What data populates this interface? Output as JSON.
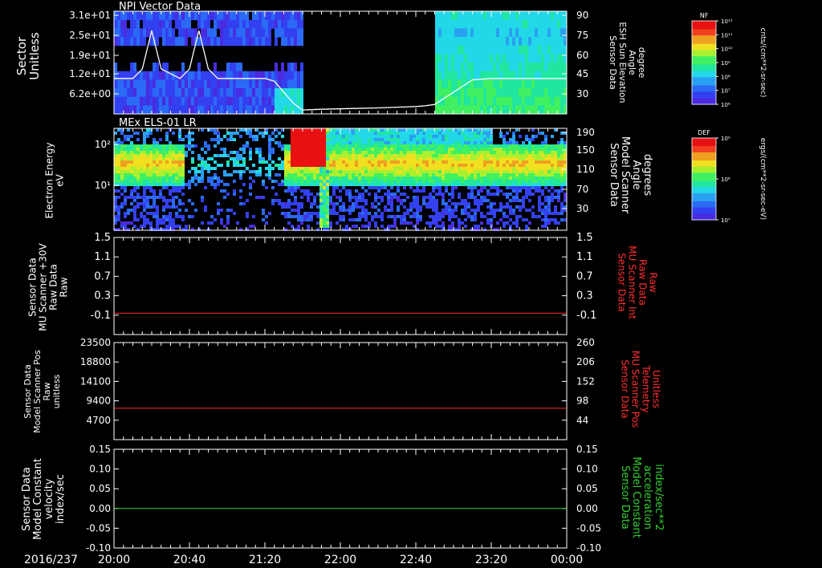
{
  "chart_data": [
    {
      "type": "heatmap",
      "title": "NPI Vector Data",
      "ylabel_left": [
        "Sector",
        "Unitless"
      ],
      "yticks_left": [
        "3.1e+01",
        "2.5e+01",
        "1.9e+01",
        "1.2e+01",
        "6.2e+00"
      ],
      "ylabel_right": [
        "Sensor Data",
        "ESH Sun Elevation",
        "Angle",
        "degree"
      ],
      "yticks_right": [
        "90",
        "75",
        "60",
        "45",
        "30"
      ],
      "colorbar": {
        "title": "NF",
        "ticks": [
          "10¹²",
          "10¹¹",
          "10¹⁰",
          "10⁹",
          "10⁸",
          "10⁷",
          "10⁶"
        ],
        "unit": "cnts/(cm**2-sr-sec)"
      },
      "overlay_line": {
        "name": "ESH Sun Elevation Angle",
        "x": [
          0,
          10,
          15,
          20,
          25,
          35,
          40,
          45,
          50,
          55,
          60,
          70,
          75,
          80,
          85,
          90,
          95,
          100,
          110,
          125,
          140,
          150,
          160,
          165,
          170,
          180,
          190,
          200,
          210,
          220,
          240
        ],
        "y": [
          45,
          45,
          52,
          80,
          52,
          45,
          52,
          80,
          52,
          45,
          45,
          45,
          45,
          45,
          43,
          35,
          27,
          22,
          22.5,
          23,
          23.5,
          24,
          24.5,
          25,
          26,
          35,
          44,
          45,
          45,
          45,
          45
        ]
      }
    },
    {
      "type": "heatmap",
      "title": "MEx ELS-01 LR",
      "ylabel_left": [
        "Electron Energy",
        "eV"
      ],
      "yticks_left": [
        "10²",
        "10¹"
      ],
      "ylabel_right": [
        "Sensor Data",
        "Model Scanner",
        "Angle",
        "degrees"
      ],
      "yticks_right": [
        "190",
        "150",
        "110",
        "70",
        "30"
      ],
      "colorbar": {
        "title": "DEF",
        "ticks": [
          "10⁹",
          "10⁸",
          "10⁷"
        ],
        "unit": "ergs/(cm**2-sr-sec-eV)"
      }
    },
    {
      "type": "line",
      "ylabel_left": [
        "Sensor Data",
        "MU Scanner +30V",
        "Raw Data",
        "Raw"
      ],
      "yticks_left": [
        "1.5",
        "1.1",
        "0.7",
        "0.3",
        "-0.1"
      ],
      "ylabel_right": [
        "Sensor Data",
        "MU Scanner Int",
        "Raw Data",
        "Raw"
      ],
      "yticks_right": [
        "1.5",
        "1.1",
        "0.7",
        "0.3",
        "-0.1"
      ],
      "ylim": [
        -0.5,
        1.5
      ],
      "series": [
        {
          "x": [
            0,
            240
          ],
          "y": [
            -0.06,
            -0.06
          ],
          "color": "#ff3030"
        }
      ]
    },
    {
      "type": "line",
      "ylabel_left": [
        "Sensor Data",
        "Model Scanner Pos",
        "Raw",
        "unitless"
      ],
      "yticks_left": [
        "23500",
        "18800",
        "14100",
        "9400",
        "4700"
      ],
      "ylabel_right": [
        "Sensor Data",
        "MU Scanner Pos",
        "Telemetry",
        "Unitless"
      ],
      "yticks_right": [
        "260",
        "206",
        "152",
        "98",
        "44"
      ],
      "ylim": [
        0,
        23500
      ],
      "series": [
        {
          "x": [
            0,
            240
          ],
          "y": [
            7600,
            7600
          ],
          "color": "#ff3030"
        }
      ]
    },
    {
      "type": "line",
      "ylabel_left": [
        "Sensor Data",
        "Model Constant",
        "velocity",
        "index/sec"
      ],
      "yticks_left": [
        "0.15",
        "0.10",
        "0.05",
        "0.00",
        "-0.05",
        "-0.10"
      ],
      "ylabel_right": [
        "Sensor Data",
        "Model Constant",
        "acceleration",
        "index/sec**2"
      ],
      "yticks_right": [
        "0.15",
        "0.10",
        "0.05",
        "0.00",
        "-0.05",
        "-0.10"
      ],
      "ylim": [
        -0.1,
        0.15
      ],
      "series": [
        {
          "x": [
            0,
            240
          ],
          "y": [
            0,
            0
          ],
          "color": "#30d030"
        }
      ]
    }
  ],
  "x_axis": {
    "date": "2016/237",
    "ticks": [
      "20:00",
      "20:40",
      "21:20",
      "22:00",
      "22:40",
      "23:20",
      "00:00"
    ]
  },
  "colors": {
    "label_white": "#ffffff",
    "label_red": "#ff3030",
    "label_green": "#30d030"
  }
}
